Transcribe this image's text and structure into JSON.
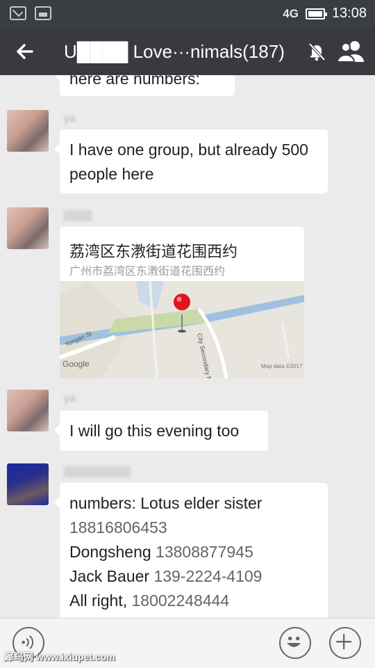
{
  "status_bar": {
    "network": "4G",
    "time": "13:08",
    "left_icons": [
      "mail-icon",
      "image-icon"
    ]
  },
  "header": {
    "title": "U████ Love···nimals(187)",
    "back_icon": "back-arrow-icon",
    "mute_icon": "mute-bell-icon",
    "members_icon": "group-members-icon"
  },
  "messages": [
    {
      "type": "text",
      "sender": "",
      "text": "here are numbers:"
    },
    {
      "type": "text",
      "sender": "ya",
      "text": "I have one group, but already 500 people here"
    },
    {
      "type": "location",
      "sender": "",
      "place": "荔湾区东漖街道花围西约",
      "address": "广州市荔湾区东漖街道花围西约",
      "map_labels": {
        "provider": "Google",
        "credit": "Map data ©2017",
        "street1": "Yongan St",
        "street2": "City Secondary Main"
      }
    },
    {
      "type": "text",
      "sender": "ya",
      "text": "I will go this evening too"
    },
    {
      "type": "contacts",
      "sender": "",
      "lines": [
        {
          "label": "numbers: Lotus elder sister",
          "number": ""
        },
        {
          "label": "",
          "number": "18816806453"
        },
        {
          "label": "Dongsheng ",
          "number": "13808877945"
        },
        {
          "label": "Jack Bauer ",
          "number": "139-2224-4109"
        },
        {
          "label": "All right, ",
          "number": "18002248444"
        }
      ]
    }
  ],
  "input_bar": {
    "voice_icon": "voice-icon",
    "emoji_icon": "emoji-icon",
    "plus_icon": "plus-icon"
  },
  "watermark": "犀鸟网 www.ixiupet.com"
}
